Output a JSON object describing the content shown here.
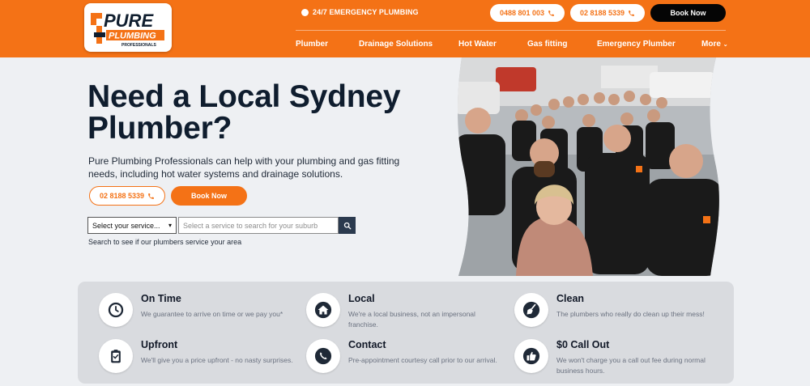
{
  "brand": {
    "logo_word": "PURE",
    "logo_sub": "PLUMBING",
    "logo_small": "PROFESSIONALS",
    "accent": "#f47216",
    "dark": "#0f1d2e"
  },
  "header": {
    "emergency": "24/7 EMERGENCY PLUMBING",
    "phone_mobile": "0488 801 003",
    "phone_landline": "02 8188 5339",
    "book_now": "Book Now"
  },
  "nav": [
    "Plumber",
    "Drainage Solutions",
    "Hot Water",
    "Gas fitting",
    "Emergency Plumber",
    "More"
  ],
  "hero": {
    "title": "Need a Local Sydney Plumber?",
    "description": "Pure Plumbing Professionals can help with your plumbing and gas fitting needs, including hot water systems and drainage solutions.",
    "phone_button": "02 8188 5339",
    "book_button": "Book Now",
    "service_select": "Select your service...",
    "suburb_placeholder": "Select a service to search for your suburb",
    "search_hint": "Search to see if our plumbers service your area"
  },
  "features": [
    {
      "icon": "clock-icon",
      "title": "On Time",
      "desc": "We guarantee to arrive on time or we pay you*"
    },
    {
      "icon": "house-icon",
      "title": "Local",
      "desc": "We're a local business, not an impersonal franchise."
    },
    {
      "icon": "broom-icon",
      "title": "Clean",
      "desc": "The plumbers who really do clean up their mess!"
    },
    {
      "icon": "clipboard-icon",
      "title": "Upfront",
      "desc": "We'll give you a price upfront - no nasty surprises."
    },
    {
      "icon": "phone-icon",
      "title": "Contact",
      "desc": "Pre-appointment courtesy call prior to our arrival."
    },
    {
      "icon": "thumbs-up-icon",
      "title": "$0 Call Out",
      "desc": "We won't charge you a call out fee during normal business hours."
    }
  ]
}
